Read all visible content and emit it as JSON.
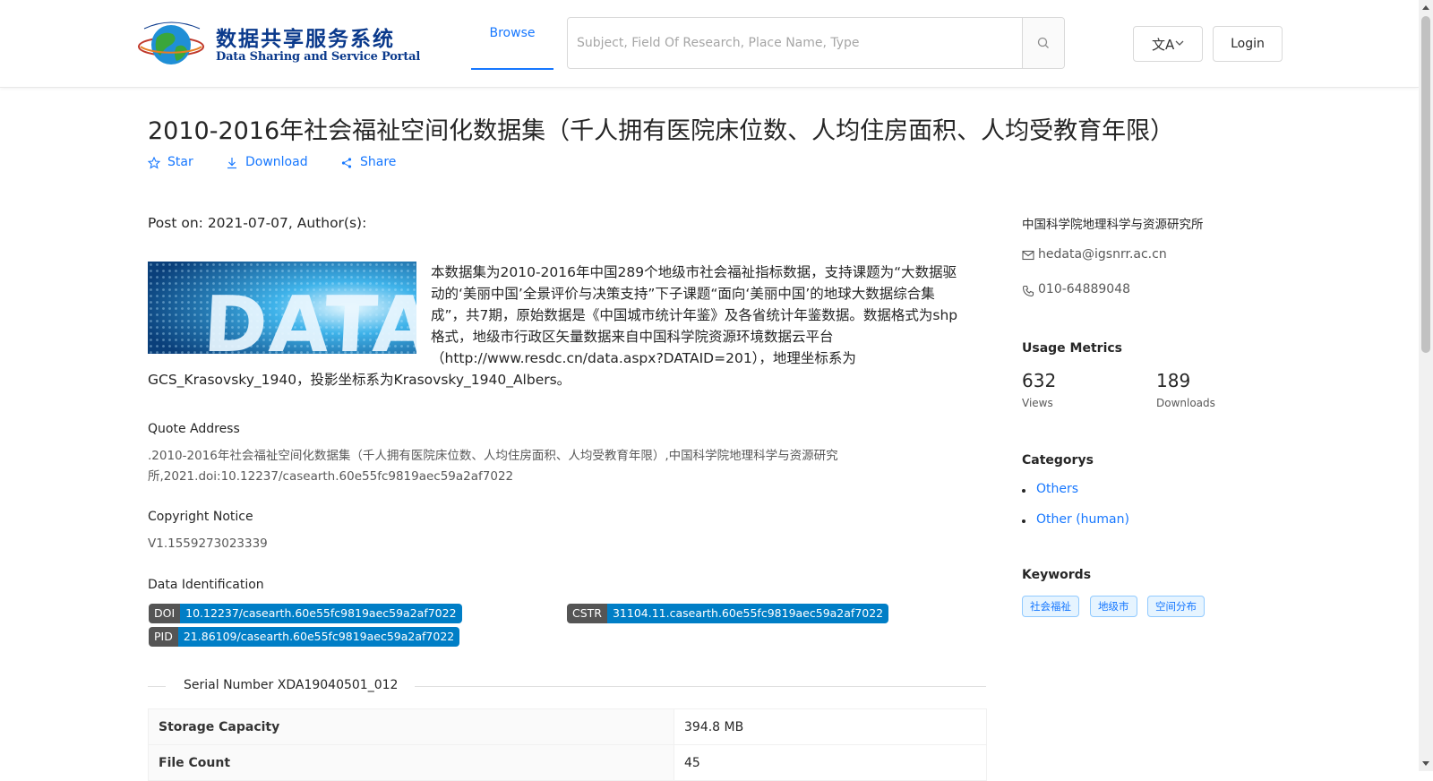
{
  "header": {
    "logo_cn": "数据共享服务系统",
    "logo_en": "Data Sharing and Service Portal",
    "nav_browse": "Browse",
    "search_placeholder": "Subject, Field Of Research, Place Name, Type",
    "lang_icon": "translate-icon",
    "login_label": "Login"
  },
  "dataset": {
    "title": "2010-2016年社会福祉空间化数据集（千人拥有医院床位数、人均住房面积、人均受教育年限）",
    "actions": {
      "star": "Star",
      "download": "Download",
      "share": "Share"
    },
    "post_on": "Post on: 2021-07-07, Author(s):",
    "image_text": "DATA",
    "description_lines": [
      "本数据集为2010-2016年中国289个地级市社会福祉指标数据，支持课题为“大数据驱",
      "动的‘美丽中国’全景评价与决策支持”下子课题“面向‘美丽中国’的地球大数据综合集",
      "成”，共7期，原始数据是《中国城市统计年鉴》及各省统计年鉴数据。数据格式为shp",
      "格式，地级市行政区矢量数据来自中国科学院资源环境数据云平台",
      "（http://www.resdc.cn/data.aspx?DATAID=201），地理坐标系为",
      "GCS_Krasovsky_1940，投影坐标系为Krasovsky_1940_Albers。"
    ],
    "quote_label": "Quote Address",
    "quote_lines": [
      ".2010-2016年社会福祉空间化数据集（千人拥有医院床位数、人均住房面积、人均受教育年限）,中国科学院地理科学与资源研究",
      "所,2021.doi:10.12237/casearth.60e55fc9819aec59a2af7022"
    ],
    "copyright_label": "Copyright Notice",
    "copyright_value": "V1.1559273023339",
    "identification_label": "Data Identification",
    "badges": {
      "doi_key": "DOI",
      "doi_val": "10.12237/casearth.60e55fc9819aec59a2af7022",
      "cstr_key": "CSTR",
      "cstr_val": "31104.11.casearth.60e55fc9819aec59a2af7022",
      "pid_key": "PID",
      "pid_val": "21.86109/casearth.60e55fc9819aec59a2af7022"
    },
    "serial_number": "Serial Number XDA19040501_012",
    "table": [
      {
        "key": "Storage Capacity",
        "value": "394.8 MB"
      },
      {
        "key": "File Count",
        "value": "45"
      }
    ]
  },
  "sidebar": {
    "organization": "中国科学院地理科学与资源研究所",
    "email": "hedata@igsnrr.ac.cn",
    "phone": "010-64889048",
    "metrics_heading": "Usage Metrics",
    "views_value": "632",
    "views_label": "Views",
    "downloads_value": "189",
    "downloads_label": "Downloads",
    "categories_heading": "Categorys",
    "categories": [
      "Others",
      "Other (human)"
    ],
    "keywords_heading": "Keywords",
    "keywords": [
      "社会福祉",
      "地级市",
      "空间分布"
    ]
  },
  "colors": {
    "accent": "#1677ff",
    "badge_key": "#555555",
    "badge_value": "#007ec6"
  }
}
